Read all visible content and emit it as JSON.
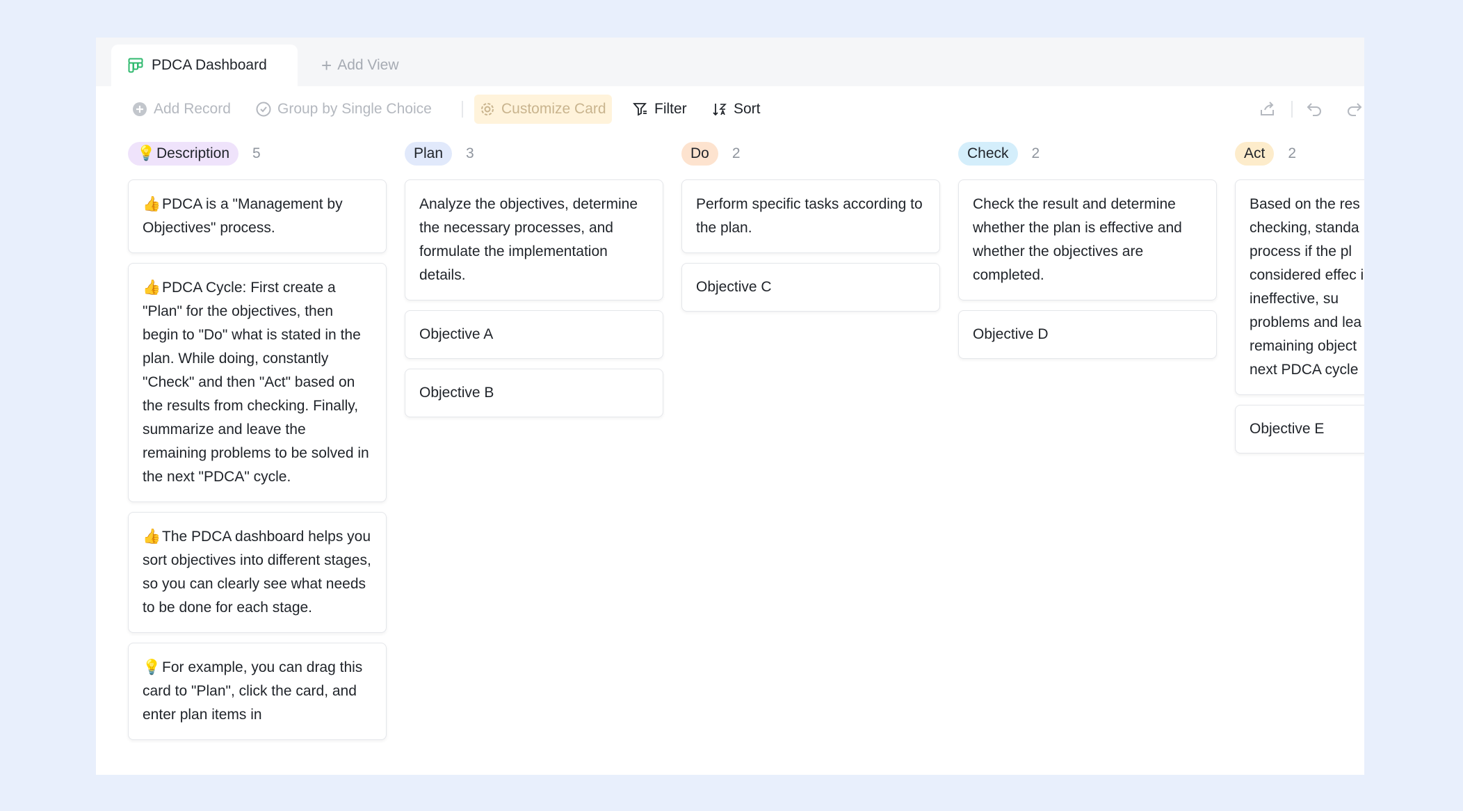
{
  "tabs": {
    "active_label": "PDCA Dashboard",
    "add_view_label": "Add View"
  },
  "toolbar": {
    "add_record": "Add Record",
    "group_by": "Group by Single Choice",
    "customize_card": "Customize Card",
    "filter": "Filter",
    "sort": "Sort"
  },
  "columns": [
    {
      "label": "Description",
      "count": "5",
      "pill_color": "#efe3fb",
      "cards": [
        {
          "emoji": "👍",
          "text": "PDCA is a \"Management by Objectives\" process."
        },
        {
          "emoji": "👍",
          "text": "PDCA Cycle: First create a \"Plan\" for the objectives, then begin to \"Do\" what is stated in the plan. While doing, constantly \"Check\" and then \"Act\" based on the results from checking. Finally, summarize and leave the remaining problems to be solved in the next \"PDCA\" cycle."
        },
        {
          "emoji": "👍",
          "text": "The PDCA dashboard helps you sort objectives into different stages, so you can clearly see what needs to be done for each stage."
        },
        {
          "emoji": "💡",
          "text": "For example, you can drag this card to \"Plan\", click the card, and enter plan items in"
        }
      ]
    },
    {
      "label": "Plan",
      "count": "3",
      "pill_color": "#e1e9fb",
      "cards": [
        {
          "text": "Analyze the objectives, determine the necessary processes, and formulate the implementation details."
        },
        {
          "text": "Objective A"
        },
        {
          "text": "Objective B"
        }
      ]
    },
    {
      "label": "Do",
      "count": "2",
      "pill_color": "#fde3cf",
      "cards": [
        {
          "text": "Perform specific tasks according to the plan."
        },
        {
          "text": "Objective C"
        }
      ]
    },
    {
      "label": "Check",
      "count": "2",
      "pill_color": "#d4eefb",
      "cards": [
        {
          "text": "Check the result and determine whether the plan is effective and whether the objectives are completed."
        },
        {
          "text": "Objective D"
        }
      ]
    },
    {
      "label": "Act",
      "count": "2",
      "pill_color": "#fdeccb",
      "cards": [
        {
          "text": "Based on the res checking, standa process if the pl considered effec is ineffective, su problems and lea remaining object next PDCA cycle"
        },
        {
          "text": "Objective E"
        }
      ]
    }
  ]
}
